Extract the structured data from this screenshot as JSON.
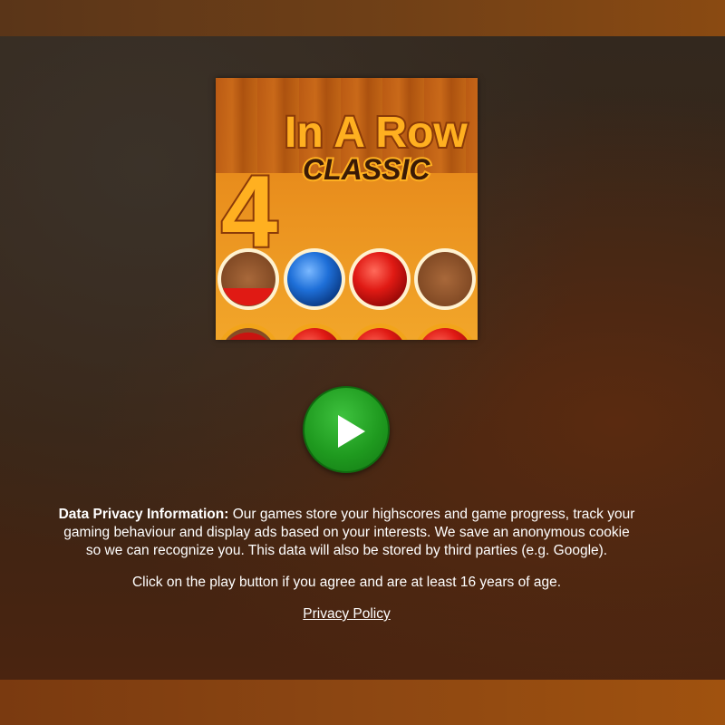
{
  "logo": {
    "number": "4",
    "line1": "In A Row",
    "line2": "CLASSIC",
    "board_colors": {
      "red": "#e01a14",
      "blue": "#1e6fd8",
      "empty": "#9a5a2c",
      "ring": "#f2a41a"
    }
  },
  "play_button": {
    "icon": "play-icon",
    "color": "#1f9a1f"
  },
  "privacy": {
    "heading": "Data Privacy Information:",
    "body": " Our games store your highscores and game progress, track your gaming behaviour and display ads based on your interests. We save an anonymous cookie so we can recognize you. This data will also be stored by third parties (e.g. Google).",
    "consent": "Click on the play button if you agree and are at least 16 years of age.",
    "policy_link": "Privacy Policy"
  }
}
